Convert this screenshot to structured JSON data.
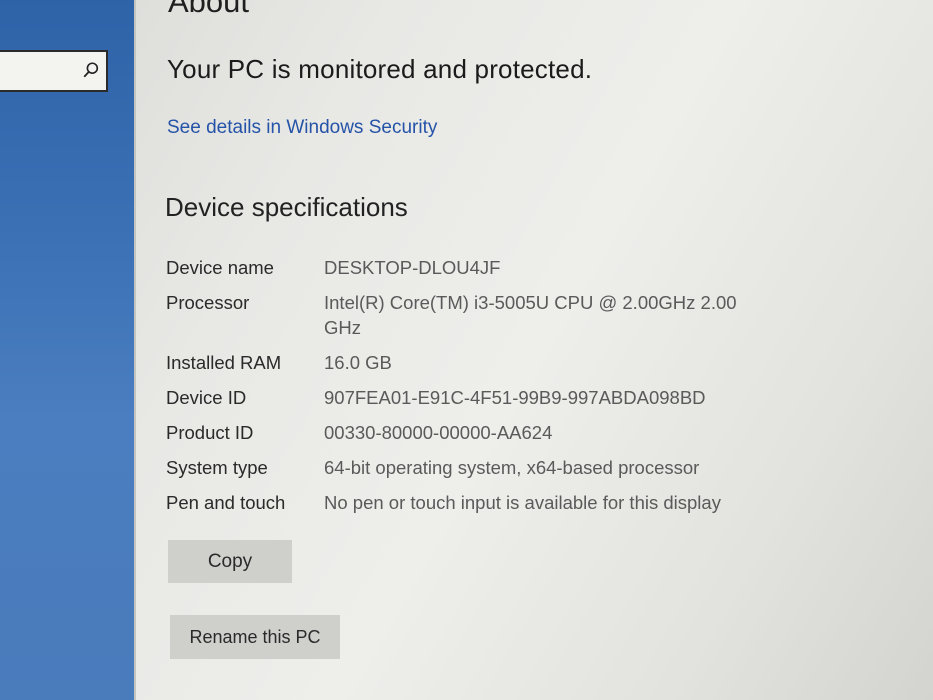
{
  "page": {
    "title": "About",
    "protection_status": "Your PC is monitored and protected.",
    "security_link": "See details in Windows Security"
  },
  "search": {
    "value": "",
    "placeholder": ""
  },
  "specs": {
    "title": "Device specifications",
    "rows": [
      {
        "label": "Device name",
        "value": "DESKTOP-DLOU4JF"
      },
      {
        "label": "Processor",
        "value": "Intel(R) Core(TM) i3-5005U CPU @ 2.00GHz   2.00 GHz"
      },
      {
        "label": "Installed RAM",
        "value": "16.0 GB"
      },
      {
        "label": "Device ID",
        "value": "907FEA01-E91C-4F51-99B9-997ABDA098BD"
      },
      {
        "label": "Product ID",
        "value": "00330-80000-00000-AA624"
      },
      {
        "label": "System type",
        "value": "64-bit operating system, x64-based processor"
      },
      {
        "label": "Pen and touch",
        "value": "No pen or touch input is available for this display"
      }
    ]
  },
  "buttons": {
    "copy": "Copy",
    "rename": "Rename this PC"
  },
  "colors": {
    "link": "#2553a8",
    "sidebar_wallpaper": "#3a6fb4",
    "button_bg": "#cfcfcc"
  }
}
